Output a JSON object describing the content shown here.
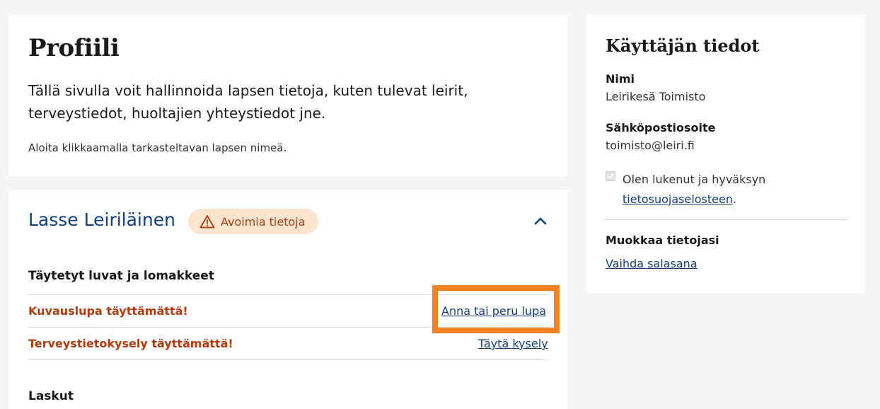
{
  "intro": {
    "title": "Profiili",
    "description": "Tällä sivulla voit hallinnoida lapsen tietoja, kuten tulevat leirit, terveystiedot, huoltajien yhteystiedot jne.",
    "hint": "Aloita klikkaamalla tarkasteltavan lapsen nimeä."
  },
  "child": {
    "name": "Lasse Leiriläinen",
    "badge": "Avoimia tietoja",
    "badge_icon": "warning-triangle-icon",
    "toggle_icon": "chevron-up-icon",
    "forms_heading": "Täytetyt luvat ja lomakkeet",
    "forms": [
      {
        "status": "Kuvauslupa täyttämättä!",
        "action": "Anna tai peru lupa"
      },
      {
        "status": "Terveystietokysely täyttämättä!",
        "action": "Täytä kysely"
      }
    ],
    "invoices_heading": "Laskut"
  },
  "user": {
    "title": "Käyttäjän tiedot",
    "name_label": "Nimi",
    "name_value": "Leirikesä Toimisto",
    "email_label": "Sähköpostiosoite",
    "email_value": "toimisto@leiri.fi",
    "consent_text": "Olen lukenut ja hyväksyn",
    "consent_link": "tietosuojaselosteen",
    "consent_suffix": ".",
    "edit_heading": "Muokkaa tietojasi",
    "change_password": "Vaihda salasana"
  },
  "colors": {
    "accent_blue": "#0f3f7e",
    "warning_text": "#b33a0c",
    "badge_bg": "#fbe5cf",
    "highlight": "#f58220"
  }
}
